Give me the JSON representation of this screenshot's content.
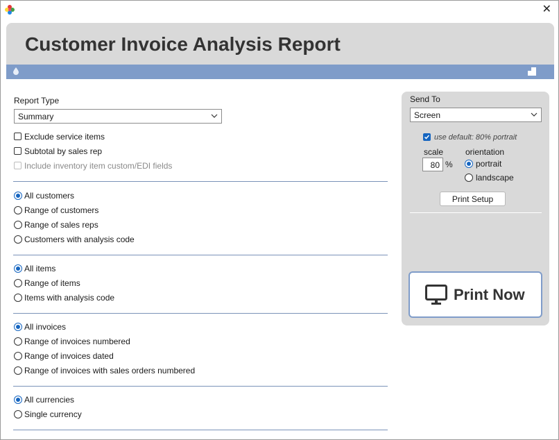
{
  "window": {
    "close_label": "✕"
  },
  "header": {
    "title": "Customer Invoice Analysis Report"
  },
  "report_type": {
    "label": "Report Type",
    "selected": "Summary",
    "options": [
      {
        "label": "Exclude service items",
        "checked": false,
        "disabled": false
      },
      {
        "label": "Subtotal by sales rep",
        "checked": false,
        "disabled": false
      },
      {
        "label": "Include inventory item custom/EDI fields",
        "checked": false,
        "disabled": true
      }
    ]
  },
  "customers": [
    "All customers",
    "Range of customers",
    "Range of sales reps",
    "Customers with analysis code"
  ],
  "items": [
    "All items",
    "Range of items",
    "Items with analysis code"
  ],
  "invoices": [
    "All invoices",
    "Range of invoices numbered",
    "Range of invoices dated",
    "Range of invoices with sales orders numbered"
  ],
  "currencies": [
    "All currencies",
    "Single currency"
  ],
  "send_to": {
    "label": "Send To",
    "selected": "Screen",
    "use_default_label": "use default: 80% portrait",
    "scale_label": "scale",
    "scale_value": "80",
    "percent": "%",
    "orientation_label": "orientation",
    "portrait": "portrait",
    "landscape": "landscape",
    "print_setup": "Print Setup",
    "print_now": "Print Now"
  },
  "colors": {
    "accent": "#1565c0",
    "header_bar": "#7f9cc9",
    "panel": "#d9d9d9"
  }
}
